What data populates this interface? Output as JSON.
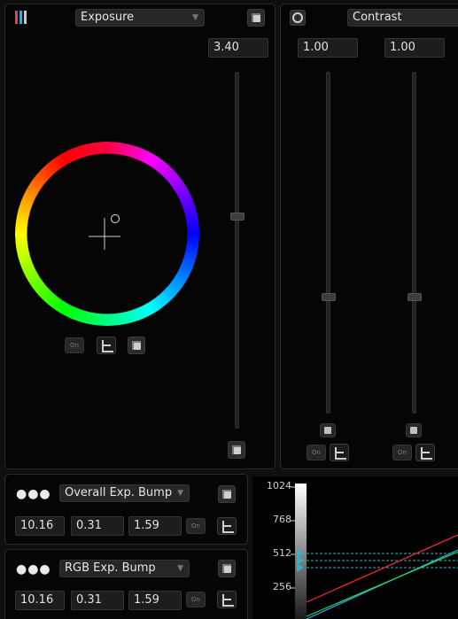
{
  "exposure_panel": {
    "title": "Exposure",
    "value": "3.40"
  },
  "contrast_panel": {
    "title": "Contrast",
    "value_left": "1.00",
    "value_right": "1.00"
  },
  "bump_panels": [
    {
      "title": "Overall Exp. Bump",
      "values": [
        "10.16",
        "0.31",
        "1.59"
      ]
    },
    {
      "title": "RGB Exp. Bump",
      "values": [
        "10.16",
        "0.31",
        "1.59"
      ]
    }
  ],
  "curve_graph": {
    "y_ticks": [
      "1024",
      "768",
      "512",
      "256"
    ],
    "line_colors": {
      "red": "#ff2a2a",
      "green": "#22dd44",
      "blue": "#3aa0ff",
      "guide": "#2fb4c8"
    }
  },
  "icons": {
    "on_button_text": "On"
  }
}
